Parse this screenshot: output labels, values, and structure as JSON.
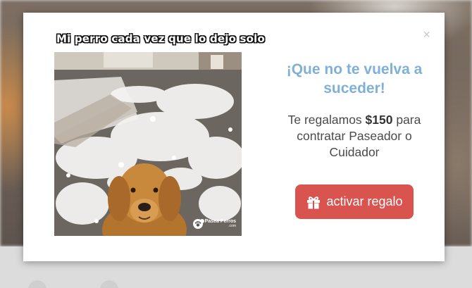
{
  "modal": {
    "close_label": "×",
    "meme_caption": "Mi perro cada vez que lo dejo solo",
    "watermark_name": "Pasea Perros",
    "watermark_domain": ".com",
    "title": "¡Que no te vuelva a suceder!",
    "text_before": "Te regalamos ",
    "amount": "$150",
    "text_after": " para contratar Paseador o Cuidador",
    "cta_label": "activar regalo",
    "cta_icon": "gift-icon"
  },
  "colors": {
    "title": "#7fb0d8",
    "cta_background": "#d9534f",
    "text": "#4a4a4a"
  }
}
